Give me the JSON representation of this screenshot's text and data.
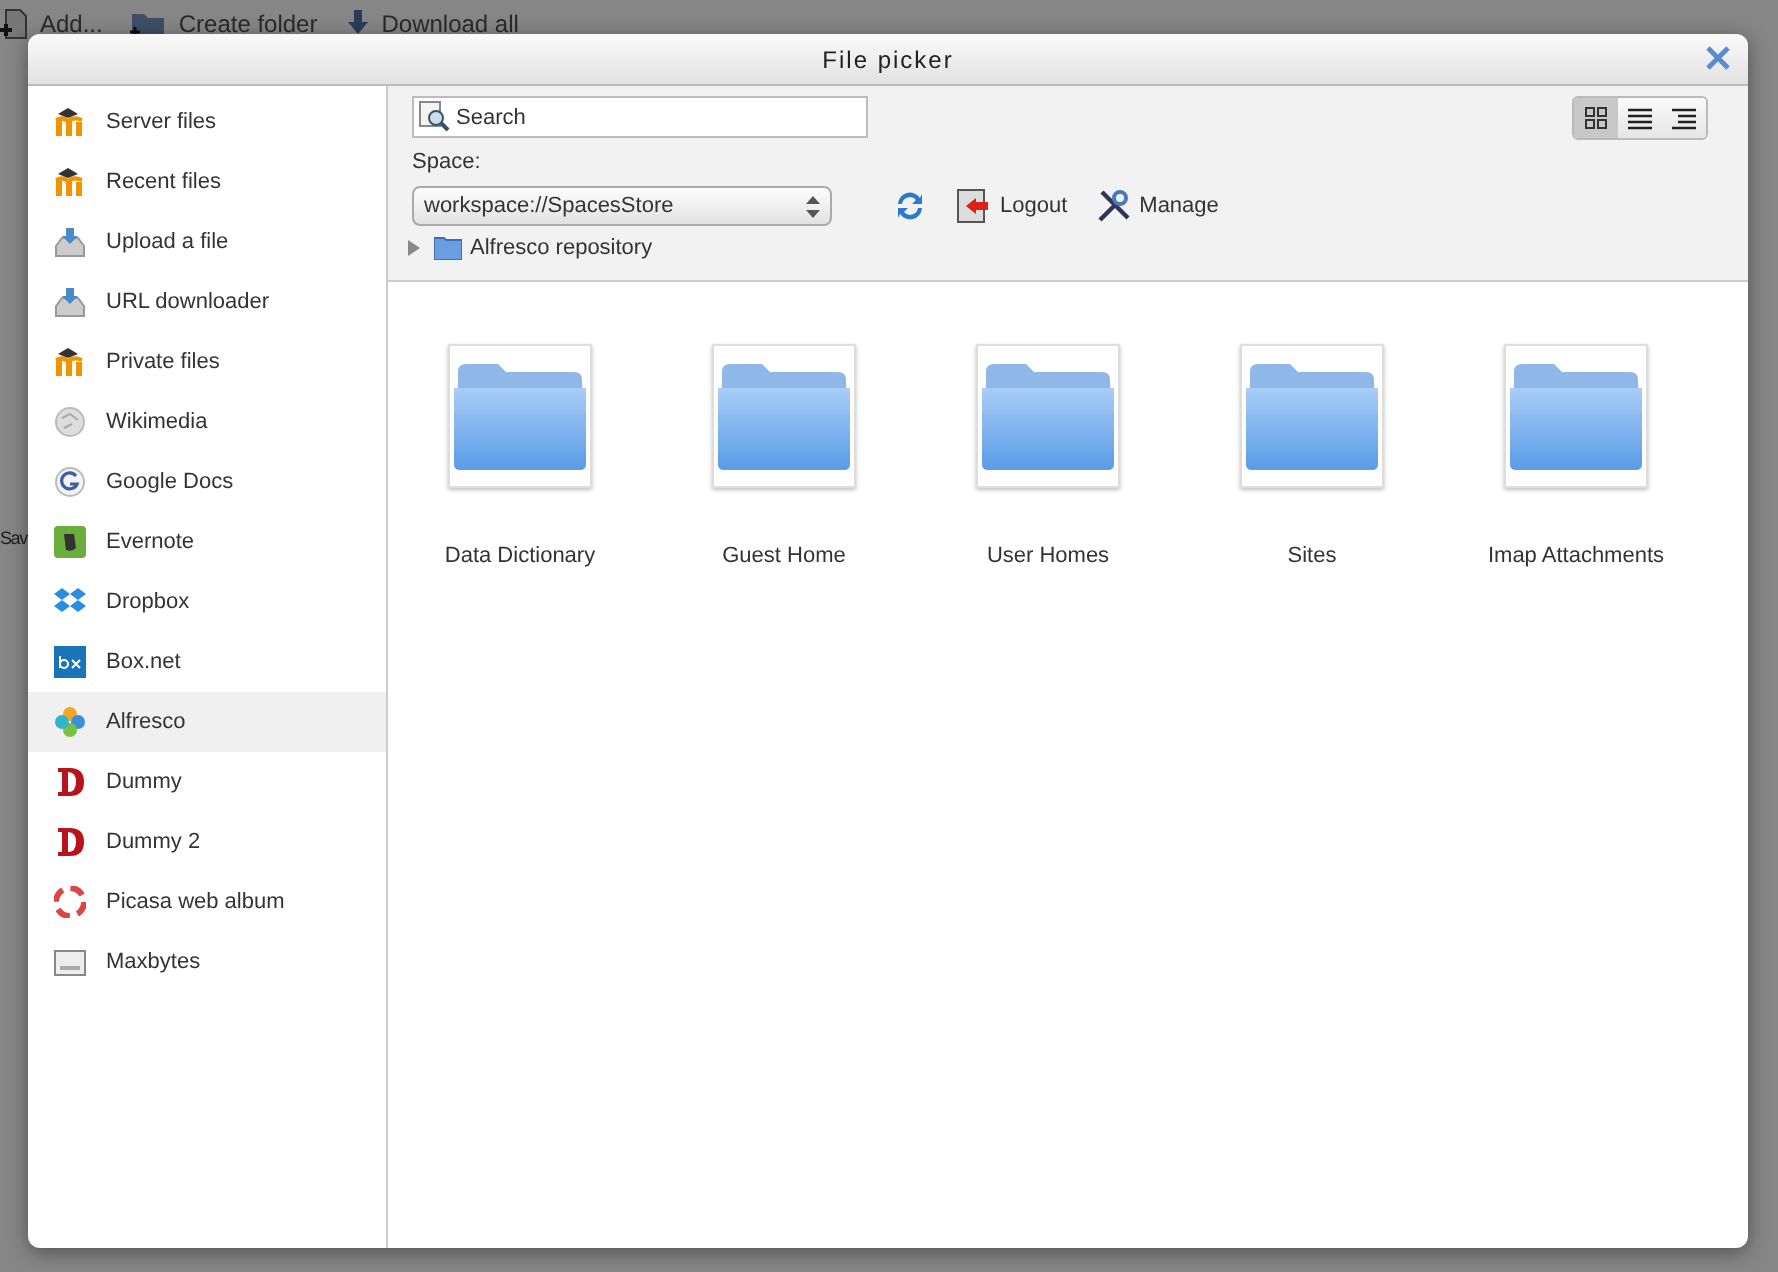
{
  "background_page": {
    "toolbar": [
      {
        "kind": "add",
        "label": "Add..."
      },
      {
        "kind": "folder",
        "label": "Create folder"
      },
      {
        "kind": "download",
        "label": "Download all"
      }
    ],
    "button_fragment": "Sav"
  },
  "dialog": {
    "title": "File picker"
  },
  "sidebar": {
    "items": [
      {
        "kind": "moodle",
        "label": "Server files",
        "selected": false
      },
      {
        "kind": "moodle",
        "label": "Recent files",
        "selected": false
      },
      {
        "kind": "upload",
        "label": "Upload a file",
        "selected": false
      },
      {
        "kind": "upload",
        "label": "URL downloader",
        "selected": false
      },
      {
        "kind": "moodle",
        "label": "Private files",
        "selected": false
      },
      {
        "kind": "wikimedia",
        "label": "Wikimedia",
        "selected": false
      },
      {
        "kind": "google",
        "label": "Google Docs",
        "selected": false
      },
      {
        "kind": "evernote",
        "label": "Evernote",
        "selected": false
      },
      {
        "kind": "dropbox",
        "label": "Dropbox",
        "selected": false
      },
      {
        "kind": "box",
        "label": "Box.net",
        "selected": false
      },
      {
        "kind": "alfresco",
        "label": "Alfresco",
        "selected": true
      },
      {
        "kind": "dummy",
        "label": "Dummy",
        "selected": false
      },
      {
        "kind": "dummy",
        "label": "Dummy 2",
        "selected": false
      },
      {
        "kind": "picasa",
        "label": "Picasa web album",
        "selected": false
      },
      {
        "kind": "maxbytes",
        "label": "Maxbytes",
        "selected": false
      }
    ]
  },
  "toolbar": {
    "search": {
      "placeholder": "Search"
    },
    "space_label": "Space:",
    "space_select": "workspace://SpacesStore",
    "actions": [
      {
        "kind": "refresh"
      },
      {
        "kind": "logout",
        "label": "Logout"
      },
      {
        "kind": "manage",
        "label": "Manage"
      }
    ],
    "view_modes": [
      {
        "kind": "icons",
        "selected": true
      },
      {
        "kind": "list",
        "selected": false
      },
      {
        "kind": "tree",
        "selected": false
      }
    ]
  },
  "path": {
    "label": "Alfresco repository",
    "expanded": false
  },
  "folders": [
    {
      "name": "Data Dictionary"
    },
    {
      "name": "Guest Home"
    },
    {
      "name": "User Homes"
    },
    {
      "name": "Sites"
    },
    {
      "name": "Imap Attachments"
    }
  ]
}
